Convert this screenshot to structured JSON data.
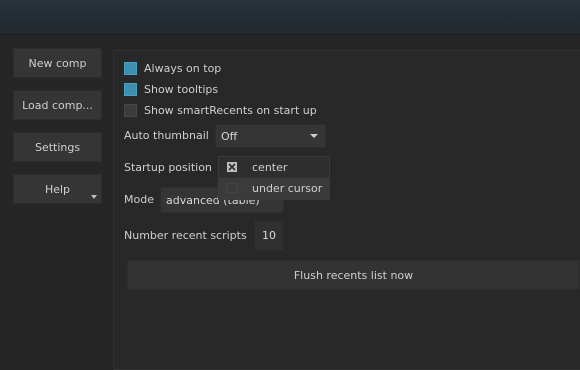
{
  "sidebar": {
    "new_comp": "New comp",
    "load_comp": "Load comp...",
    "settings": "Settings",
    "help": "Help"
  },
  "settings": {
    "always_on_top": {
      "label": "Always on top",
      "checked": true
    },
    "show_tooltips": {
      "label": "Show tooltips",
      "checked": true
    },
    "show_smartrecents": {
      "label": "Show smartRecents on start up",
      "checked": false
    },
    "auto_thumbnail": {
      "label": "Auto thumbnail",
      "value": "Off"
    },
    "startup_position": {
      "label": "Startup position",
      "options": [
        "center",
        "under cursor"
      ],
      "highlighted": "under cursor"
    },
    "mode": {
      "label": "Mode",
      "value": "advanced (table)"
    },
    "number_recent_scripts": {
      "label": "Number recent scripts",
      "value": "10"
    },
    "flush_button": "Flush recents list now"
  },
  "colors": {
    "accent": "#3f8fb0",
    "background": "#262626",
    "titlebar": "#27323a"
  },
  "icons": {
    "center_option": "move-cross-icon",
    "under_cursor_option": "empty-square-icon"
  }
}
